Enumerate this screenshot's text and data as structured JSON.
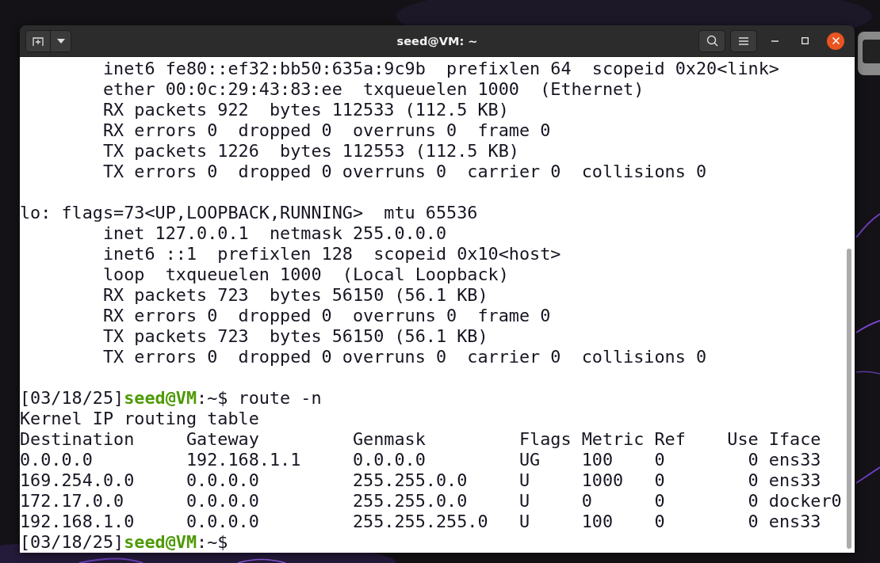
{
  "window": {
    "title": "seed@VM: ~"
  },
  "terminal": {
    "lines": [
      {
        "kind": "text",
        "text": "        inet6 fe80::ef32:bb50:635a:9c9b  prefixlen 64  scopeid 0x20<link>"
      },
      {
        "kind": "text",
        "text": "        ether 00:0c:29:43:83:ee  txqueuelen 1000  (Ethernet)"
      },
      {
        "kind": "text",
        "text": "        RX packets 922  bytes 112533 (112.5 KB)"
      },
      {
        "kind": "text",
        "text": "        RX errors 0  dropped 0  overruns 0  frame 0"
      },
      {
        "kind": "text",
        "text": "        TX packets 1226  bytes 112553 (112.5 KB)"
      },
      {
        "kind": "text",
        "text": "        TX errors 0  dropped 0 overruns 0  carrier 0  collisions 0"
      },
      {
        "kind": "blank"
      },
      {
        "kind": "text",
        "text": "lo: flags=73<UP,LOOPBACK,RUNNING>  mtu 65536"
      },
      {
        "kind": "text",
        "text": "        inet 127.0.0.1  netmask 255.0.0.0"
      },
      {
        "kind": "text",
        "text": "        inet6 ::1  prefixlen 128  scopeid 0x10<host>"
      },
      {
        "kind": "text",
        "text": "        loop  txqueuelen 1000  (Local Loopback)"
      },
      {
        "kind": "text",
        "text": "        RX packets 723  bytes 56150 (56.1 KB)"
      },
      {
        "kind": "text",
        "text": "        RX errors 0  dropped 0  overruns 0  frame 0"
      },
      {
        "kind": "text",
        "text": "        TX packets 723  bytes 56150 (56.1 KB)"
      },
      {
        "kind": "text",
        "text": "        TX errors 0  dropped 0 overruns 0  carrier 0  collisions 0"
      },
      {
        "kind": "blank"
      },
      {
        "kind": "prompt",
        "date": "[03/18/25]",
        "user": "seed@VM",
        "path": ":~$",
        "command": "route -n"
      },
      {
        "kind": "text",
        "text": "Kernel IP routing table"
      },
      {
        "kind": "text",
        "text": "Destination     Gateway         Genmask         Flags Metric Ref    Use Iface"
      },
      {
        "kind": "text",
        "text": "0.0.0.0         192.168.1.1     0.0.0.0         UG    100    0        0 ens33"
      },
      {
        "kind": "text",
        "text": "169.254.0.0     0.0.0.0         255.255.0.0     U     1000   0        0 ens33"
      },
      {
        "kind": "text",
        "text": "172.17.0.0      0.0.0.0         255.255.0.0     U     0      0        0 docker0"
      },
      {
        "kind": "text",
        "text": "192.168.1.0     0.0.0.0         255.255.255.0   U     100    0        0 ens33"
      },
      {
        "kind": "prompt",
        "date": "[03/18/25]",
        "user": "seed@VM",
        "path": ":~$"
      }
    ]
  }
}
